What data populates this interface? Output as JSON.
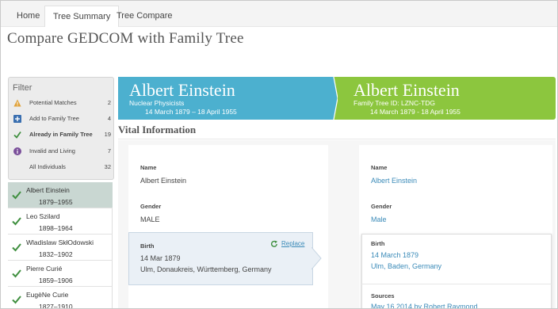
{
  "nav": {
    "tabs": [
      {
        "label": "Home"
      },
      {
        "label": "Tree Summary"
      },
      {
        "label": "Tree Compare"
      }
    ]
  },
  "page": {
    "title": "Compare GEDCOM with Family Tree"
  },
  "filter": {
    "title": "Filter",
    "items": [
      {
        "label": "Potential Matches",
        "count": "2",
        "icon": "warning-icon"
      },
      {
        "label": "Add to Family Tree",
        "count": "4",
        "icon": "plus-icon"
      },
      {
        "label": "Already in Family Tree",
        "count": "19",
        "icon": "check-icon"
      },
      {
        "label": "Invalid and Living",
        "count": "7",
        "icon": "info-icon"
      },
      {
        "label": "All Individuals",
        "count": "32",
        "icon": ""
      }
    ]
  },
  "individuals": [
    {
      "name": "Albert Einstein",
      "dates": "1879–1955"
    },
    {
      "name": "Leo Szilard",
      "dates": "1898–1964"
    },
    {
      "name": "Wladislaw SkłOdowski",
      "dates": "1832–1902"
    },
    {
      "name": "Pierre Curié",
      "dates": "1859–1906"
    },
    {
      "name": "EugèNe Curie",
      "dates": "1827–1910"
    }
  ],
  "gedcom_person": {
    "name": "Albert Einstein",
    "subtitle": "Nuclear Physicists",
    "dates": "14 March 1879 – 18 April 1955"
  },
  "tree_person": {
    "name": "Albert Einstein",
    "subtitle": "Family Tree ID: LZNC-TDG",
    "dates": "14 March 1879 - 18 April 1955"
  },
  "vital": {
    "title": "Vital Information",
    "left": {
      "name_label": "Name",
      "name_value": "Albert Einstein",
      "gender_label": "Gender",
      "gender_value": "MALE",
      "birth_label": "Birth",
      "birth_date": "14 Mar 1879",
      "birth_place": "Ulm, Donaukreis, Württemberg, Germany",
      "replace_label": "Replace"
    },
    "right": {
      "name_label": "Name",
      "name_value": "Albert Einstein",
      "gender_label": "Gender",
      "gender_value": "Male",
      "birth_label": "Birth",
      "birth_date": "14 March 1879",
      "birth_place": "Ulm, Baden, Germany",
      "sources_label": "Sources",
      "sources_value": "May 16 2014 by Robert Raymond"
    }
  },
  "colors": {
    "gedcom_banner": "#4cb0cf",
    "tree_banner": "#8cc63e",
    "link": "#3a8ab8",
    "selected_row": "#c9d7d2",
    "check_green": "#3f8f3f"
  }
}
